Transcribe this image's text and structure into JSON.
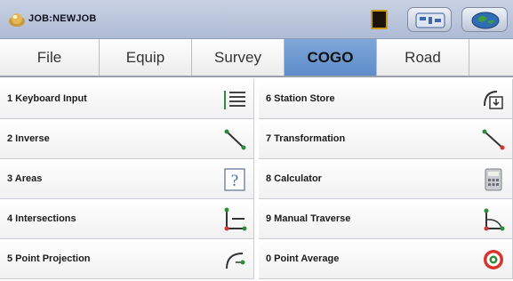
{
  "titlebar": {
    "job_title": "JOB:NEWJOB",
    "icons": [
      "app-logo-icon",
      "status-square-icon",
      "settings-icon",
      "globe-icon"
    ]
  },
  "tabs": [
    {
      "label": "File",
      "active": false
    },
    {
      "label": "Equip",
      "active": false
    },
    {
      "label": "Survey",
      "active": false
    },
    {
      "label": "COGO",
      "active": true
    },
    {
      "label": "Road",
      "active": false
    }
  ],
  "commands": {
    "left": [
      {
        "label": "1 Keyboard Input",
        "icon": "keyboard-input-icon"
      },
      {
        "label": "2 Inverse",
        "icon": "inverse-line-icon"
      },
      {
        "label": "3 Areas",
        "icon": "question-mark-icon"
      },
      {
        "label": "4 Intersections",
        "icon": "intersection-icon"
      },
      {
        "label": "5 Point Projection",
        "icon": "point-projection-icon"
      }
    ],
    "right": [
      {
        "label": "6 Station Store",
        "icon": "station-store-icon"
      },
      {
        "label": "7 Transformation",
        "icon": "transformation-line-icon"
      },
      {
        "label": "8 Calculator",
        "icon": "calculator-icon"
      },
      {
        "label": "9 Manual Traverse",
        "icon": "manual-traverse-icon"
      },
      {
        "label": "0 Point Average",
        "icon": "point-average-icon"
      }
    ]
  },
  "colors": {
    "active_tab": "#6b97d0",
    "titlebar": "#b9c4db",
    "accent_red": "#d8332c",
    "accent_green": "#2e8b3a"
  }
}
